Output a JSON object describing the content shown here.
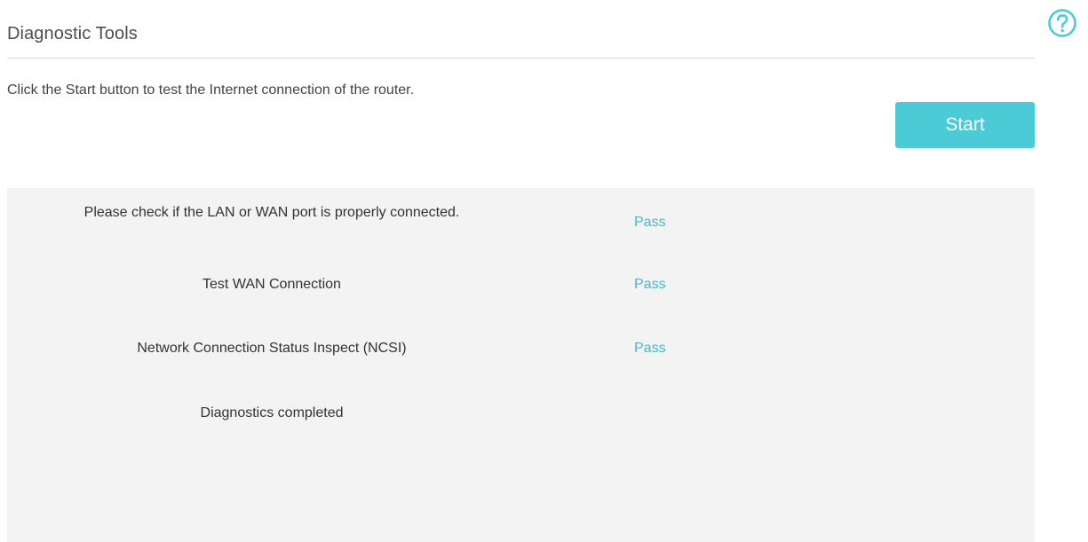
{
  "header": {
    "title": "Diagnostic Tools",
    "help_icon": "question-circle-icon",
    "help_color": "#4acbd6"
  },
  "main": {
    "description": "Click the Start button to test the Internet connection of the router.",
    "start_label": "Start",
    "accent_color": "#4acbd6",
    "results": [
      {
        "label": "Please check if the LAN or WAN port is properly connected.",
        "status": "Pass"
      },
      {
        "label": "Test WAN Connection",
        "status": "Pass"
      },
      {
        "label": "Network Connection Status Inspect (NCSI)",
        "status": "Pass"
      },
      {
        "label": "Diagnostics completed",
        "status": ""
      }
    ]
  }
}
